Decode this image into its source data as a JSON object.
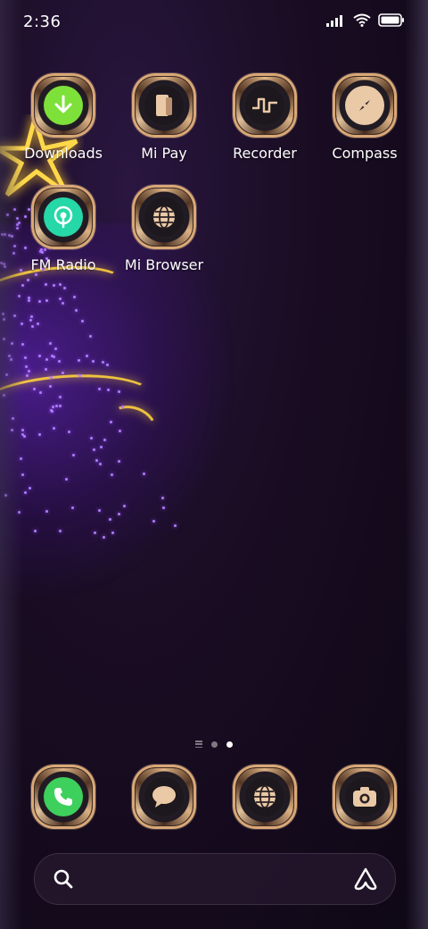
{
  "status_bar": {
    "time": "2:36",
    "icons": [
      "signal-icon",
      "wifi-icon",
      "battery-icon"
    ]
  },
  "apps": [
    {
      "label": "Downloads",
      "icon": "download-icon",
      "accent": "#7ee13a"
    },
    {
      "label": "Mi Pay",
      "icon": "wallet-icon",
      "accent": "#e9c9a6"
    },
    {
      "label": "Recorder",
      "icon": "waveform-icon",
      "accent": "#e9c9a6"
    },
    {
      "label": "Compass",
      "icon": "compass-icon",
      "accent": "#e9c9a6"
    },
    {
      "label": "FM Radio",
      "icon": "radio-icon",
      "accent": "#26d7a8"
    },
    {
      "label": "Mi Browser",
      "icon": "globe-icon",
      "accent": "#e9c9a6"
    }
  ],
  "dock": [
    {
      "name": "phone",
      "icon": "phone-icon",
      "accent": "#3ed05c"
    },
    {
      "name": "messages",
      "icon": "message-icon",
      "accent": "#e9c9a6"
    },
    {
      "name": "browser",
      "icon": "globe-icon",
      "accent": "#e9c9a6"
    },
    {
      "name": "camera",
      "icon": "camera-icon",
      "accent": "#e9c9a6"
    }
  ],
  "page_indicator": {
    "pages": 2,
    "active": 2
  },
  "search": {
    "icon": "search-icon",
    "assistant_icon": "assistant-icon"
  }
}
